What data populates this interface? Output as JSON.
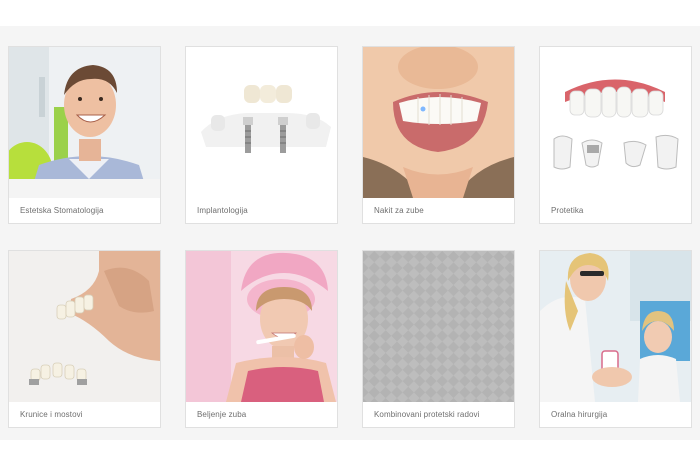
{
  "services": [
    {
      "label": "Estetska Stomatologija",
      "image": "smiling-patient-photo"
    },
    {
      "label": "Implantologija",
      "image": "dental-implant-bridge-illustration"
    },
    {
      "label": "Nakit za zube",
      "image": "tooth-jewel-smile-photo"
    },
    {
      "label": "Protetika",
      "image": "veneers-crowns-model-illustration"
    },
    {
      "label": "Krunice i mostovi",
      "image": "crowns-bridges-photo"
    },
    {
      "label": "Beljenje zuba",
      "image": "woman-brushing-teeth-photo"
    },
    {
      "label": "Kombinovani protetski radovi",
      "image": "placeholder-pattern"
    },
    {
      "label": "Oralna hirurgija",
      "image": "dentist-child-photo"
    }
  ],
  "colors": {
    "page_background": "#f5f5f5",
    "card_border": "#e0e0e0",
    "label_text": "#6e6e6e"
  }
}
